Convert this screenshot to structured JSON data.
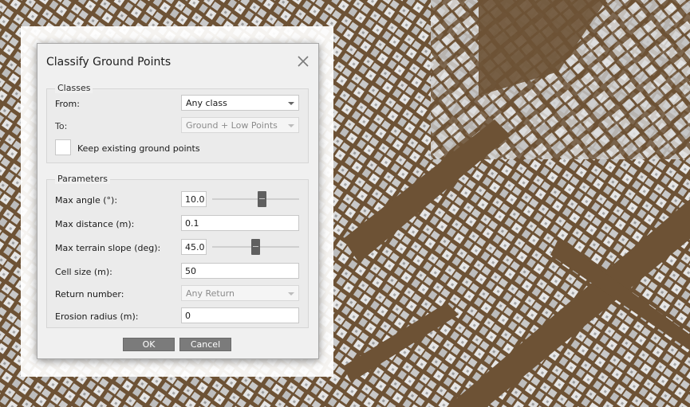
{
  "dialog": {
    "title": "Classify Ground Points",
    "close_icon": "close-icon"
  },
  "classes": {
    "group_title": "Classes",
    "from_label": "From:",
    "from_value": "Any class",
    "to_label": "To:",
    "to_value": "Ground + Low Points",
    "keep_label": "Keep existing ground points",
    "keep_checked": false
  },
  "parameters": {
    "group_title": "Parameters",
    "max_angle_label": "Max angle (°):",
    "max_angle_value": "10.0",
    "max_angle_slider_fraction": 0.58,
    "max_distance_label": "Max distance (m):",
    "max_distance_value": "0.1",
    "max_slope_label": "Max terrain slope (deg):",
    "max_slope_value": "45.0",
    "max_slope_slider_fraction": 0.5,
    "cell_size_label": "Cell size (m):",
    "cell_size_value": "50",
    "return_number_label": "Return number:",
    "return_number_value": "Any Return",
    "erosion_radius_label": "Erosion radius (m):",
    "erosion_radius_value": "0"
  },
  "buttons": {
    "ok_label": "OK",
    "cancel_label": "Cancel"
  },
  "colors": {
    "terrain": "#6d5235",
    "buildings": "#d6d6d6",
    "button_bg": "#7b7b7b"
  }
}
